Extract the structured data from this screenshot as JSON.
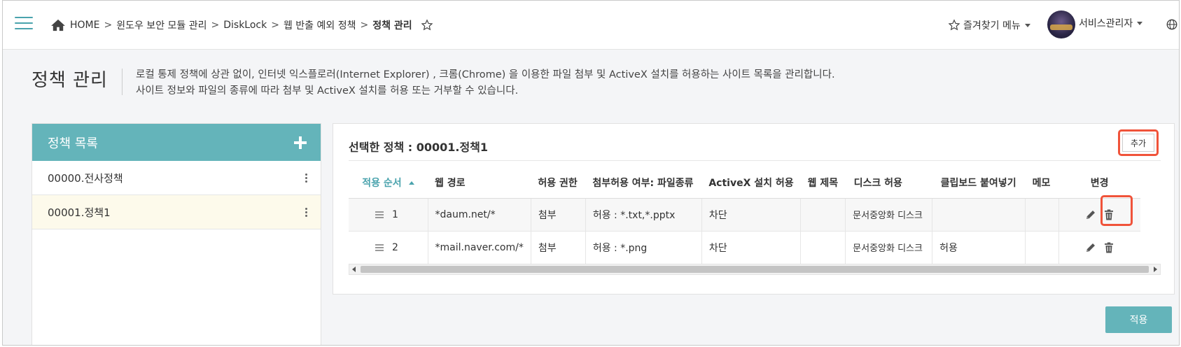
{
  "breadcrumb": {
    "items": [
      "HOME",
      "윈도우 보안 모듈 관리",
      "DiskLock",
      "웹 반출 예외 정책",
      "정책 관리"
    ],
    "separator": ">"
  },
  "header": {
    "favorites_label": "즐겨찾기 메뉴",
    "user_label": "서비스관리자"
  },
  "page": {
    "title": "정책 관리",
    "desc_line1": "로컬 통제 정책에 상관 없이, 인터넷 익스플로러(Internet Explorer) , 크롬(Chrome) 을 이용한 파일 첨부 및 ActiveX 설치를 허용하는 사이트 목록을 관리합니다.",
    "desc_line2": "사이트 정보와 파일의 종류에 따라 첨부 및 ActiveX 설치를 허용 또는 거부할 수 있습니다."
  },
  "policy_list": {
    "title": "정책 목록",
    "items": [
      {
        "label": "00000.전사정책"
      },
      {
        "label": "00001.정책1"
      }
    ]
  },
  "detail": {
    "selected_title": "선택한 정책 : 00001.정책1",
    "add_label": "추가",
    "columns": [
      "적용 순서",
      "웹 경로",
      "허용 권한",
      "첨부허용 여부: 파일종류",
      "ActiveX 설치 허용",
      "웹 제목",
      "디스크 허용",
      "클립보드 붙여넣기",
      "메모",
      "변경"
    ],
    "rows": [
      {
        "order": "1",
        "path": "*daum.net/*",
        "perm": "첨부",
        "attach": "허용 : *.txt,*.pptx",
        "activex": "차단",
        "title": "",
        "disk": "문서중앙화 디스크",
        "clipboard": "",
        "memo": ""
      },
      {
        "order": "2",
        "path": "*mail.naver.com/*",
        "perm": "첨부",
        "attach": "허용 : *.png",
        "activex": "차단",
        "title": "",
        "disk": "문서중앙화 디스크",
        "clipboard": "허용",
        "memo": ""
      }
    ],
    "apply_label": "적용"
  },
  "colors": {
    "accent": "#64b4ba",
    "sort_active": "#4aa3ad",
    "highlight": "#f0533a",
    "selected_row": "#fdfaeb"
  }
}
